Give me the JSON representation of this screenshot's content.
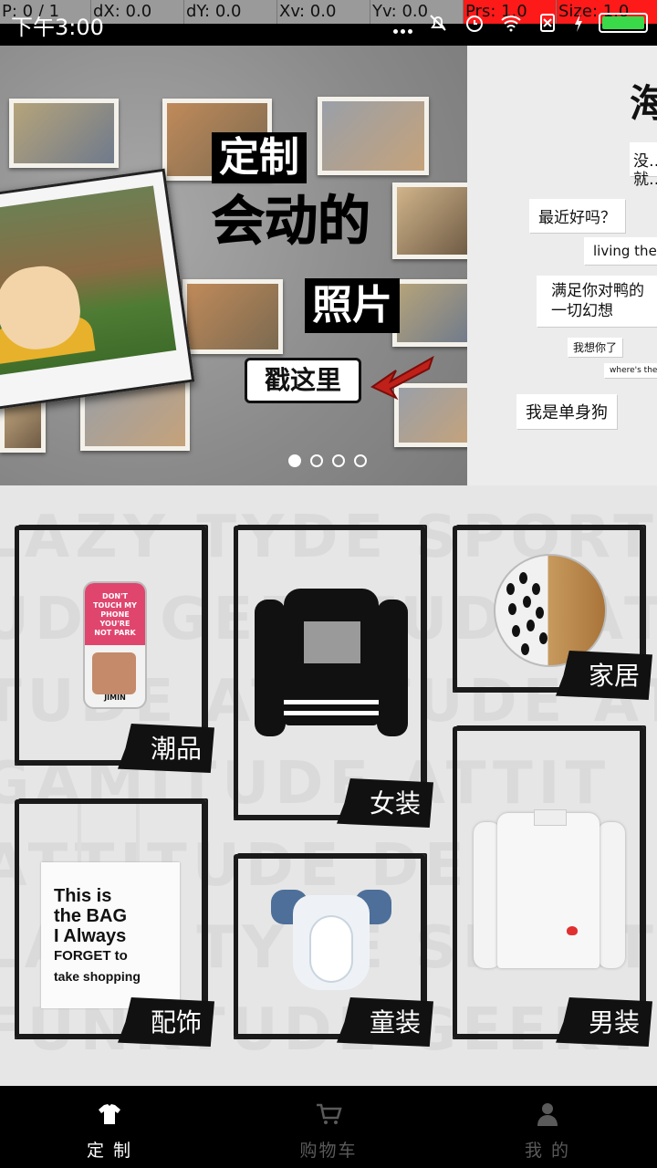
{
  "debug_bar": {
    "p": "P: 0 / 1",
    "dx": "dX: 0.0",
    "dy": "dY: 0.0",
    "xv": "Xv: 0.0",
    "yv": "Yv: 0.0",
    "prs": "Prs: 1.0",
    "size": "Size: 1.0"
  },
  "status_bar": {
    "time": "下午3:00"
  },
  "banner": {
    "headline_1": "定制",
    "headline_2": "会动的",
    "headline_3": "照片",
    "cta": "戳这里",
    "page_count": 4,
    "current_page": 1,
    "next_slide": {
      "title": "海",
      "bubbles": [
        "没…",
        "就…",
        "最近好吗？",
        "living the",
        "满足你对鸭的",
        "一切幻想",
        "我想你了",
        "where's the fo",
        "我是单身狗"
      ]
    }
  },
  "categories": [
    {
      "label": "潮品",
      "icon": "phone-case-image"
    },
    {
      "label": "女装",
      "icon": "hoodie-image"
    },
    {
      "label": "家居",
      "icon": "plate-image"
    },
    {
      "label": "配饰",
      "icon": "tote-bag-image"
    },
    {
      "label": "童装",
      "icon": "onesie-image"
    },
    {
      "label": "男装",
      "icon": "shirt-image"
    }
  ],
  "product_text": {
    "case_print": "DON'T TOUCH MY PHONE YOU'RE NOT PARK",
    "case_name": "JIMIN",
    "tote_line_1": "This is",
    "tote_line_2": "the BAG",
    "tote_line_3": "I Always",
    "tote_line_4": "FORGET to",
    "tote_line_5": "take shopping"
  },
  "bottom_nav": {
    "items": [
      {
        "label": "定 制",
        "icon": "tshirt-icon",
        "active": true
      },
      {
        "label": "购物车",
        "icon": "cart-icon",
        "active": false
      },
      {
        "label": "我 的",
        "icon": "person-icon",
        "active": false
      }
    ]
  }
}
